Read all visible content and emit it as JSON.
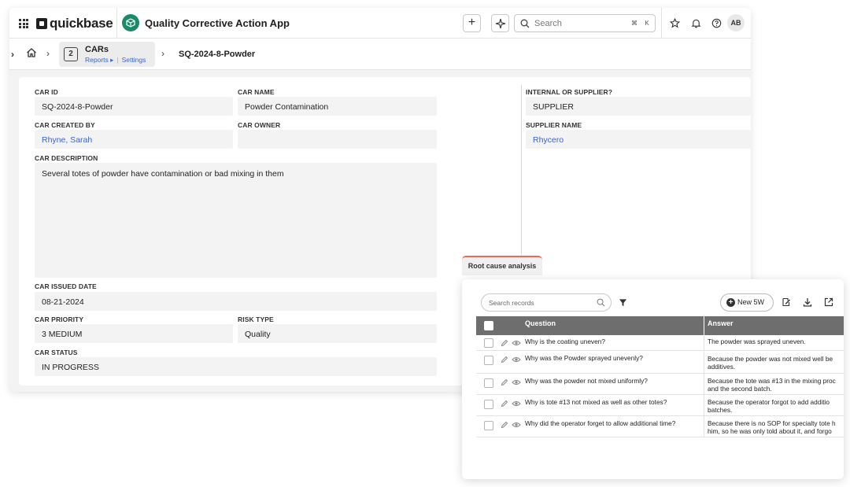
{
  "app": {
    "brand": "quickbase",
    "name": "Quality Corrective Action App",
    "search_placeholder": "Search",
    "shortcut_cmd": "⌘",
    "shortcut_key": "K",
    "avatar_initials": "AB",
    "accent_color": "#1b8a6b"
  },
  "breadcrumb": {
    "table_number": "2",
    "table_name": "CARs",
    "reports_link": "Reports",
    "settings_link": "Settings",
    "record": "SQ-2024-8-Powder"
  },
  "form": {
    "car_id": {
      "label": "CAR ID",
      "value": "SQ-2024-8-Powder"
    },
    "car_name": {
      "label": "CAR NAME",
      "value": "Powder Contamination"
    },
    "internal_or_supplier": {
      "label": "INTERNAL OR SUPPLIER?",
      "value": "SUPPLIER"
    },
    "car_created_by": {
      "label": "CAR CREATED BY",
      "value": "Rhyne, Sarah"
    },
    "car_owner": {
      "label": "CAR OWNER",
      "value": ""
    },
    "supplier_name": {
      "label": "SUPPLIER NAME",
      "value": "Rhycero"
    },
    "car_description": {
      "label": "CAR DESCRIPTION",
      "value": "Several totes of powder have contamination or bad mixing in them"
    },
    "car_issued_date": {
      "label": "CAR ISSUED DATE",
      "value": "08-21-2024"
    },
    "car_priority": {
      "label": "CAR PRIORITY",
      "value": "3 MEDIUM"
    },
    "risk_type": {
      "label": "RISK TYPE",
      "value": "Quality"
    },
    "car_status": {
      "label": "CAR STATUS",
      "value": "IN PROGRESS"
    }
  },
  "rca": {
    "tab_label": "Root cause analysis",
    "search_placeholder": "Search records",
    "new_button": "New 5W",
    "columns": [
      "Question",
      "Answer"
    ],
    "rows": [
      {
        "question": "Why is the coating uneven?",
        "answer": "The powder was sprayed uneven."
      },
      {
        "question": "Why was the Powder sprayed unevenly?",
        "answer": "Because the powder was not mixed well be",
        "answer2": "additives."
      },
      {
        "question": "Why was the powder not mixed uniformly?",
        "answer": "Because the tote was #13 in the mixing proc",
        "answer2": "and the second batch."
      },
      {
        "question": "Why is tote #13 not mixed as well as other totes?",
        "answer": "Because the operator forgot to add additio",
        "answer2": "batches."
      },
      {
        "question": "Why did the operator forget to allow additional time?",
        "answer": "Because there is no SOP for specialty tote h",
        "answer2": "him, so he was only told about it, and forgo"
      }
    ]
  }
}
